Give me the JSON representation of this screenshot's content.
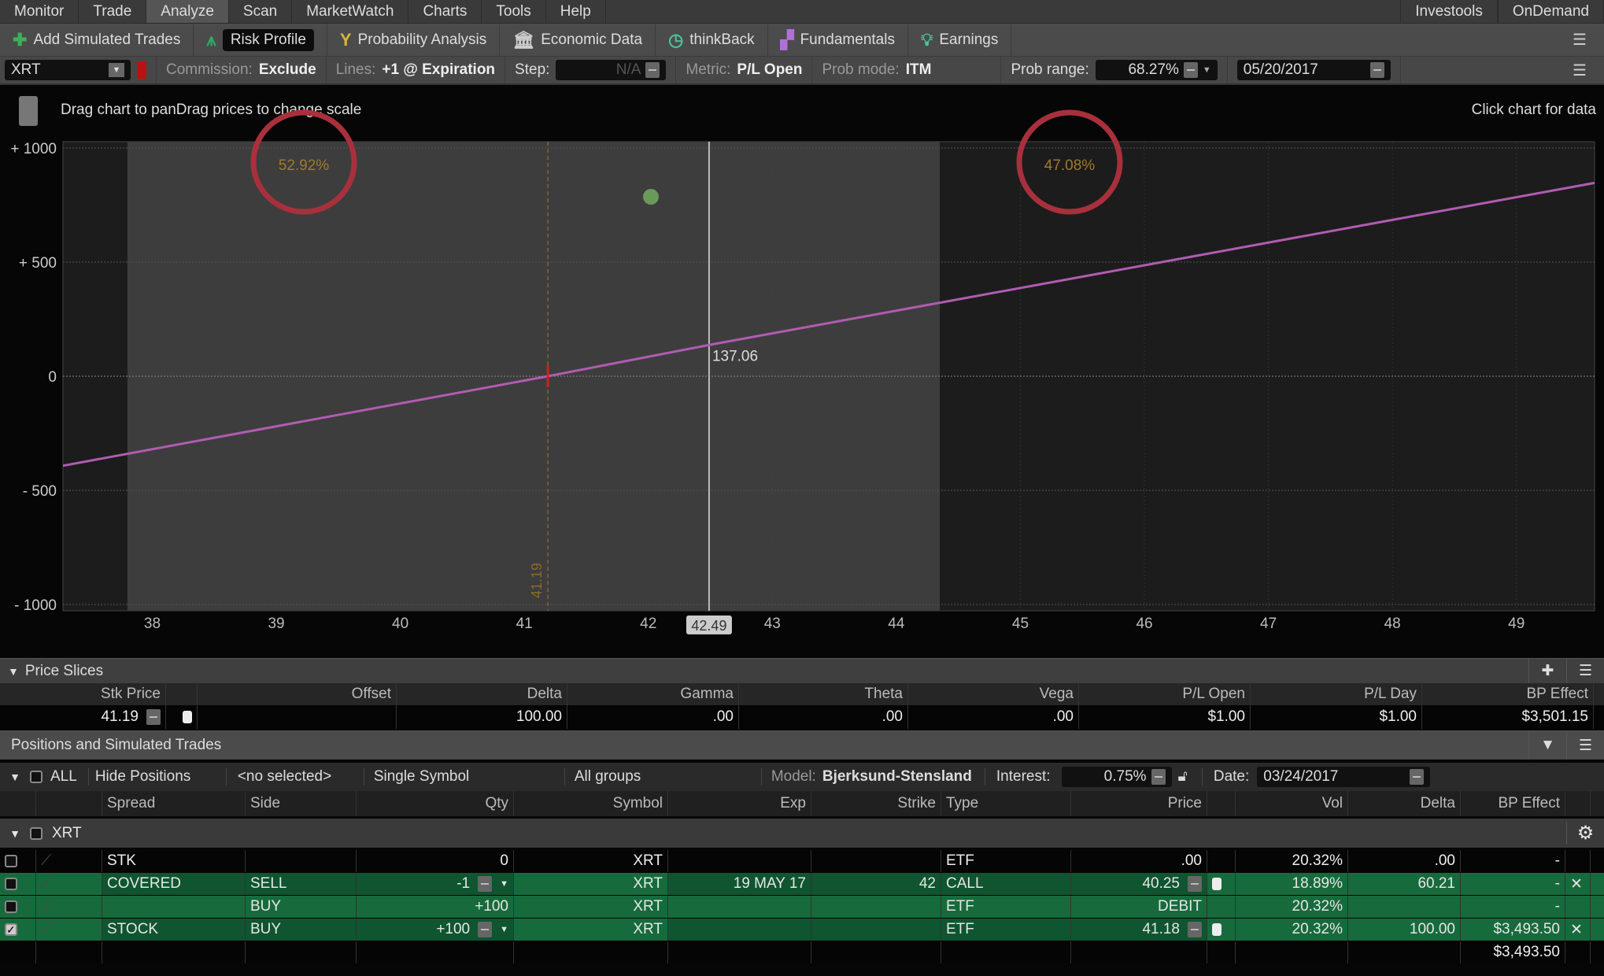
{
  "menu": {
    "items": [
      "Monitor",
      "Trade",
      "Analyze",
      "Scan",
      "MarketWatch",
      "Charts",
      "Tools",
      "Help"
    ],
    "active": "Analyze",
    "right": [
      "Investools",
      "OnDemand"
    ]
  },
  "toolbar": {
    "items": [
      {
        "label": "Add Simulated Trades",
        "icon": "plus-icon",
        "color": "#3fae5a"
      },
      {
        "label": "Risk Profile",
        "icon": "risk-profile-icon",
        "color": "#2fa86a"
      },
      {
        "label": "Probability Analysis",
        "icon": "probability-icon",
        "color": "#d7b63a"
      },
      {
        "label": "Economic Data",
        "icon": "building-icon",
        "color": "#cccccc"
      },
      {
        "label": "thinkBack",
        "icon": "clock-icon",
        "color": "#4fc39a"
      },
      {
        "label": "Fundamentals",
        "icon": "fundamentals-icon",
        "color": "#b070d8"
      },
      {
        "label": "Earnings",
        "icon": "lightbulb-icon",
        "color": "#4fc39a"
      }
    ],
    "active": "Risk Profile"
  },
  "controls": {
    "symbol": "XRT",
    "commission_label": "Commission:",
    "commission": "Exclude",
    "lines_label": "Lines:",
    "lines": "+1 @ Expiration",
    "step_label": "Step:",
    "step": "N/A",
    "metric_label": "Metric:",
    "metric": "P/L Open",
    "prob_mode_label": "Prob mode:",
    "prob_mode": "ITM",
    "prob_range_label": "Prob range:",
    "prob_range": "68.27%",
    "date": "05/20/2017"
  },
  "chart": {
    "hint": "Drag chart to panDrag prices to change scale",
    "click_hint": "Click chart for data"
  },
  "chart_data": {
    "type": "line",
    "xlim": [
      37.28,
      49.63
    ],
    "ylim": [
      -1000,
      1000
    ],
    "yticks": [
      {
        "v": 1000,
        "label": "+ 1000"
      },
      {
        "v": 500,
        "label": "+ 500"
      },
      {
        "v": 0,
        "label": "0"
      },
      {
        "v": -500,
        "label": "- 500"
      },
      {
        "v": -1000,
        "label": "- 1000"
      }
    ],
    "xticks": [
      38,
      39,
      40,
      41,
      42,
      43,
      44,
      45,
      46,
      47,
      48,
      49
    ],
    "series": [
      {
        "points": [
          [
            37.28,
            -392
          ],
          [
            41.19,
            0
          ],
          [
            42.49,
            137.06
          ],
          [
            49.63,
            847
          ]
        ],
        "color": "#b05cb0"
      }
    ],
    "prob_range": [
      37.8,
      44.35
    ],
    "prob_below": "52.92%",
    "prob_above": "47.08%",
    "current_price": 41.19,
    "current_price_label": "41.19",
    "cursor_x": 42.49,
    "cursor_x_label": "42.49",
    "cursor_value": "137.06",
    "grid": true,
    "annotation_color": "#a8303c"
  },
  "price_slices": {
    "title": "Price Slices",
    "headers": [
      "Stk Price",
      "",
      "Offset",
      "Delta",
      "Gamma",
      "Theta",
      "Vega",
      "P/L Open",
      "P/L Day",
      "BP Effect"
    ],
    "values": [
      "41.19",
      "",
      "",
      "100.00",
      ".00",
      ".00",
      ".00",
      "$1.00",
      "$1.00",
      "$3,501.15"
    ]
  },
  "positions": {
    "title": "Positions and Simulated Trades",
    "filters": {
      "all": "ALL",
      "hide": "Hide Positions",
      "selected": "<no selected>",
      "symbol_mode": "Single Symbol",
      "groups": "All groups",
      "model_label": "Model:",
      "model": "Bjerksund-Stensland",
      "interest_label": "Interest:",
      "interest": "0.75%",
      "date_label": "Date:",
      "date": "03/24/2017"
    },
    "headers": [
      "",
      "",
      "Spread",
      "Side",
      "Qty",
      "Symbol",
      "Exp",
      "Strike",
      "Type",
      "Price",
      "",
      "Vol",
      "Delta",
      "BP Effect",
      ""
    ],
    "group": "XRT",
    "rows": [
      {
        "checked": false,
        "green": false,
        "spread": "STK",
        "side": "",
        "qty": "0",
        "symbol": "XRT",
        "exp": "",
        "strike": "",
        "type": "ETF",
        "price": ".00",
        "lock": false,
        "vol": "20.32%",
        "delta": ".00",
        "bp": "-",
        "remove": false
      },
      {
        "checked": false,
        "green": true,
        "spread": "COVERED",
        "side": "SELL",
        "qty": "-1",
        "symbol": "XRT",
        "exp": "19 MAY 17",
        "strike": "42",
        "type": "CALL",
        "price": "40.25",
        "lock": true,
        "vol": "18.89%",
        "delta": "60.21",
        "bp": "-",
        "remove": true,
        "editable": true
      },
      {
        "checked": false,
        "green": true,
        "spread": "",
        "side": "BUY",
        "qty": "+100",
        "symbol": "XRT",
        "exp": "",
        "strike": "",
        "type": "ETF",
        "price": "DEBIT",
        "lock": false,
        "vol": "20.32%",
        "delta": "",
        "bp": "-",
        "remove": false
      },
      {
        "checked": true,
        "green": true,
        "spread": "STOCK",
        "side": "BUY",
        "qty": "+100",
        "symbol": "XRT",
        "exp": "",
        "strike": "",
        "type": "ETF",
        "price": "41.18",
        "lock": true,
        "vol": "20.32%",
        "delta": "100.00",
        "bp": "$3,493.50",
        "remove": true,
        "editable": true
      }
    ],
    "total_bp": "$3,493.50"
  }
}
